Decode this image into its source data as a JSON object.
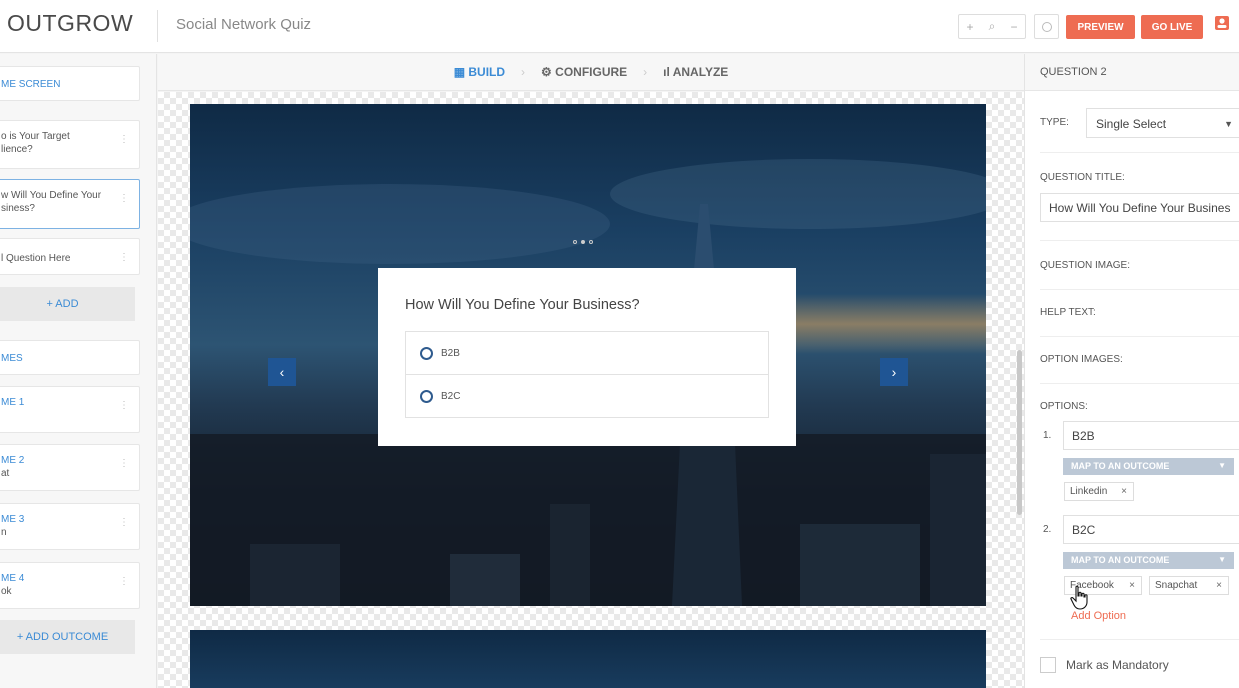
{
  "header": {
    "logo": "OUTGROW",
    "project_title": "Social Network Quiz",
    "zoom_in": "+",
    "zoom_search": "⌕",
    "zoom_out": "−",
    "preview_label": "PREVIEW",
    "go_live_label": "GO LIVE"
  },
  "sidebar": {
    "welcome_screen": "ME SCREEN",
    "questions": [
      {
        "line1": "o is Your Target",
        "line2": "lience?"
      },
      {
        "line1": "w Will You Define Your",
        "line2": "siness?"
      },
      {
        "line1": "l Question Here",
        "line2": ""
      }
    ],
    "add_label": "+ ADD",
    "outcomes_header": "MES",
    "outcomes": [
      {
        "title": "ME 1",
        "sub": ""
      },
      {
        "title": "ME 2",
        "sub": "at"
      },
      {
        "title": "ME 3",
        "sub": "n"
      },
      {
        "title": "ME 4",
        "sub": "ok"
      }
    ],
    "add_outcome_label": "+ ADD OUTCOME"
  },
  "stages": {
    "build": "BUILD",
    "configure": "CONFIGURE",
    "analyze": "ANALYZE",
    "separator": "›"
  },
  "slide": {
    "question": "How Will You Define Your Business?",
    "options": [
      "B2B",
      "B2C"
    ],
    "prev_arrow": "‹",
    "next_arrow": "›"
  },
  "panel": {
    "header": "QUESTION 2",
    "type_label": "TYPE:",
    "type_value": "Single Select",
    "title_label": "QUESTION TITLE:",
    "title_value": "How Will You Define Your Busines",
    "image_label": "QUESTION IMAGE:",
    "help_label": "HELP TEXT:",
    "option_images_label": "OPTION IMAGES:",
    "options_label": "OPTIONS:",
    "options": [
      {
        "num": "1.",
        "value": "B2B",
        "map_label": "MAP TO AN OUTCOME",
        "tags": [
          "Linkedin"
        ]
      },
      {
        "num": "2.",
        "value": "B2C",
        "map_label": "MAP TO AN OUTCOME",
        "tags": [
          "Facebook",
          "Snapchat"
        ]
      }
    ],
    "add_option": "Add Option",
    "mandatory_label": "Mark as Mandatory"
  },
  "colors": {
    "accent_blue": "#3b8bd5",
    "brand_orange": "#ee6c52",
    "nav_blue": "#1f5594"
  }
}
